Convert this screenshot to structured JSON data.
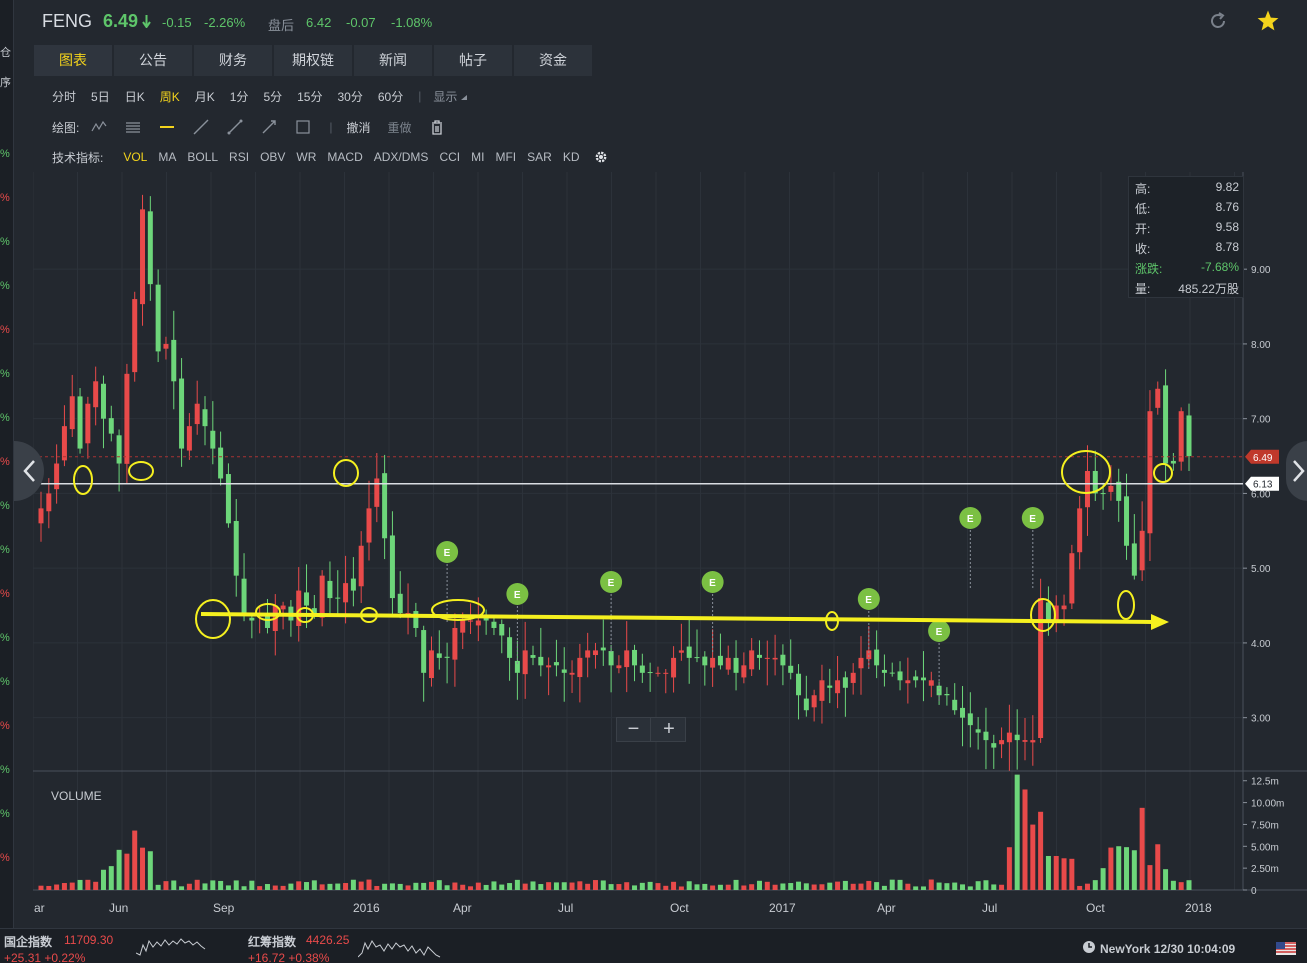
{
  "left_strip": {
    "items": [
      "仓",
      "序",
      "%",
      "%",
      "%",
      "%",
      "%",
      "%",
      "%",
      "%",
      "%",
      "%",
      "%",
      "%",
      "%",
      "%",
      "%",
      "%",
      "%"
    ]
  },
  "header": {
    "ticker": "FENG",
    "price": "6.49",
    "change": "-0.15",
    "change_pct": "-2.26%",
    "after_hours_label": "盘后",
    "after_hours_price": "6.42",
    "after_hours_change": "-0.07",
    "after_hours_pct": "-1.08%",
    "icons": [
      "refresh-icon",
      "star-icon"
    ]
  },
  "tabs": [
    {
      "label": "图表",
      "active": true
    },
    {
      "label": "公告"
    },
    {
      "label": "财务"
    },
    {
      "label": "期权链"
    },
    {
      "label": "新闻"
    },
    {
      "label": "帖子"
    },
    {
      "label": "资金"
    }
  ],
  "periods": {
    "items": [
      "分时",
      "5日",
      "日K",
      "周K",
      "月K",
      "1分",
      "5分",
      "15分",
      "30分",
      "60分"
    ],
    "active": "周K",
    "display_label": "显示"
  },
  "draw": {
    "label": "绘图:",
    "undo_label": "撤消",
    "redo_label": "重做"
  },
  "indicators": {
    "label": "技术指标:",
    "items": [
      "VOL",
      "MA",
      "BOLL",
      "RSI",
      "OBV",
      "WR",
      "MACD",
      "ADX/DMS",
      "CCI",
      "MI",
      "MFI",
      "SAR",
      "KD"
    ],
    "active": "VOL"
  },
  "infobox": {
    "high_label": "高:",
    "high": "9.82",
    "low_label": "低:",
    "low": "8.76",
    "open_label": "开:",
    "open": "9.58",
    "close_label": "收:",
    "close": "8.78",
    "change_label": "涨跌:",
    "change": "-7.68%",
    "volume_label": "量:",
    "volume": "485.22万股"
  },
  "volume_label": "VOLUME",
  "zoom": {
    "minus": "−",
    "plus": "+"
  },
  "bottom": {
    "index1_name": "国企指数",
    "index1_value": "11709.30",
    "index1_change": "+25.31 +0.22%",
    "index2_name": "红筹指数",
    "index2_value": "4426.25",
    "index2_change": "+16.72 +0.38%",
    "clock": "NewYork 12/30 10:04:09"
  },
  "chart_data": {
    "type": "candlestick",
    "price_axis": {
      "ticks": [
        "9.00",
        "8.00",
        "7.00",
        "6.00",
        "5.00",
        "4.00",
        "3.00"
      ],
      "ylim": [
        2.3,
        10.3
      ]
    },
    "volume_axis": {
      "ticks": [
        "12.5m",
        "10.00m",
        "7.50m",
        "5.00m",
        "2.50m",
        "0"
      ],
      "ylim": [
        0,
        13.5
      ]
    },
    "x_ticks": [
      "ar",
      "Jun",
      "Sep",
      "2016",
      "Apr",
      "Jul",
      "Oct",
      "2017",
      "Apr",
      "Jul",
      "Oct",
      "2018"
    ],
    "current_price_tag": "6.49",
    "horizontal_line_tag": "6.13",
    "horizontal_line_value": 6.13,
    "earnings_marker_label": "E",
    "earnings_marker_weeks": [
      52,
      61,
      73,
      86,
      106,
      115,
      119,
      127
    ],
    "weeks": 148,
    "closes": [
      5.8,
      6.0,
      6.4,
      6.9,
      7.3,
      6.6,
      7.2,
      7.5,
      7.0,
      6.8,
      6.4,
      7.6,
      8.6,
      9.8,
      8.8,
      7.9,
      8.0,
      7.5,
      6.6,
      6.9,
      7.2,
      6.9,
      6.6,
      6.2,
      5.6,
      4.9,
      4.4,
      4.3,
      4.4,
      4.2,
      4.5,
      4.5,
      4.3,
      4.7,
      4.5,
      4.4,
      4.9,
      4.6,
      4.6,
      4.8,
      4.7,
      5.3,
      5.8,
      6.2,
      5.4,
      4.6,
      4.4,
      4.4,
      4.2,
      3.6,
      3.9,
      3.8,
      3.8,
      4.2,
      4.3,
      4.3,
      4.3,
      4.3,
      4.2,
      4.1,
      3.8,
      3.6,
      3.9,
      3.8,
      3.7,
      3.7,
      3.7,
      3.6,
      3.6,
      3.8,
      3.9,
      3.9,
      3.9,
      3.7,
      3.7,
      3.9,
      3.7,
      3.6,
      3.6,
      3.6,
      3.6,
      3.8,
      3.9,
      3.8,
      3.8,
      3.7,
      3.8,
      3.7,
      3.8,
      3.6,
      3.7,
      3.9,
      3.8,
      3.8,
      3.8,
      3.7,
      3.6,
      3.3,
      3.1,
      3.3,
      3.5,
      3.4,
      3.5,
      3.4,
      3.6,
      3.8,
      3.9,
      3.7,
      3.6,
      3.6,
      3.5,
      3.5,
      3.5,
      3.5,
      3.5,
      3.3,
      3.3,
      3.1,
      3.0,
      2.9,
      2.8,
      2.7,
      2.6,
      2.7,
      2.8,
      2.7,
      2.7,
      2.7,
      4.6,
      4.3,
      4.5,
      4.5,
      5.2,
      5.8,
      6.3,
      6.0,
      6.0,
      6.1,
      5.9,
      5.3,
      4.9,
      5.5,
      7.1,
      7.4,
      6.4,
      6.4,
      7.1,
      6.5
    ]
  }
}
